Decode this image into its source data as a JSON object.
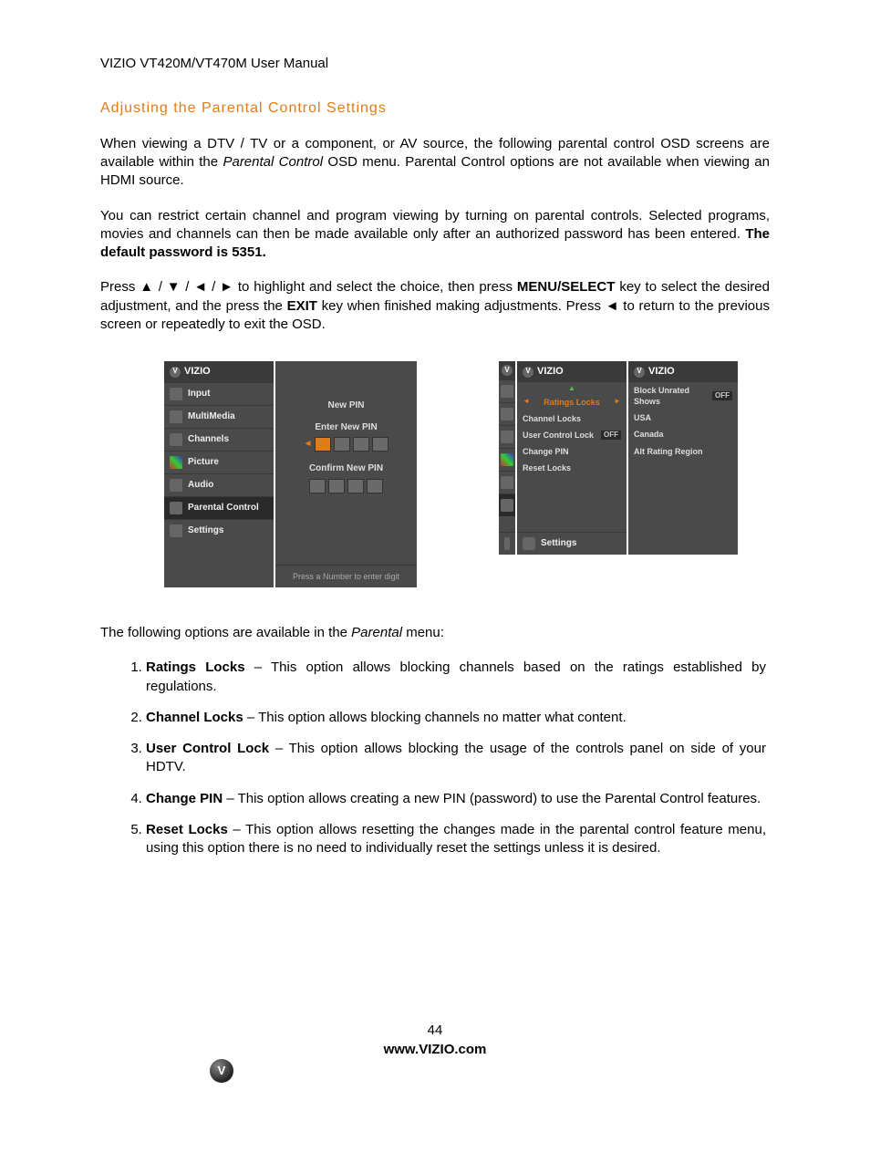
{
  "header": "VIZIO VT420M/VT470M User Manual",
  "title": "Adjusting the Parental Control Settings",
  "para1_a": "When viewing a DTV / TV or a component, or AV source, the following parental control OSD screens are available within the ",
  "para1_italic": "Parental Control",
  "para1_b": " OSD menu. Parental Control options are not available when viewing an HDMI source.",
  "para2_a": "You can restrict certain channel and program viewing by turning on parental controls. Selected programs, movies and channels can then be made available only after an authorized password has been entered. ",
  "para2_bold": "The default password is 5351.",
  "para3_a": "Press ",
  "para3_arrows": "▲ / ▼ / ◄ / ►",
  "para3_b": " to highlight and select the choice, then press ",
  "para3_menu": "MENU/SELECT",
  "para3_c": " key to select the desired adjustment, and the press the ",
  "para3_exit": "EXIT",
  "para3_d": " key when finished making adjustments. Press ",
  "para3_left": "◄",
  "para3_e": " to return to the previous screen or repeatedly to exit the OSD.",
  "osd": {
    "brand": "VIZIO",
    "sidebar": [
      "Input",
      "MultiMedia",
      "Channels",
      "Picture",
      "Audio",
      "Parental Control",
      "Settings"
    ],
    "newpin": {
      "title": "New PIN",
      "enter": "Enter New PIN",
      "confirm": "Confirm New PIN",
      "hint": "Press a Number to enter digit"
    },
    "parental_submenu": {
      "items": [
        {
          "label": "Ratings Locks",
          "hl": true,
          "arrows": true
        },
        {
          "label": "Channel Locks"
        },
        {
          "label": "User Control Lock",
          "badge": "OFF"
        },
        {
          "label": "Change PIN"
        },
        {
          "label": "Reset Locks"
        }
      ],
      "settings": "Settings"
    },
    "ratings_submenu": {
      "items": [
        {
          "label": "Block Unrated Shows",
          "badge": "OFF"
        },
        {
          "label": "USA"
        },
        {
          "label": "Canada"
        },
        {
          "label": "Alt Rating Region"
        }
      ]
    }
  },
  "options_intro_a": "The following options are available in the ",
  "options_intro_i": "Parental",
  "options_intro_b": " menu:",
  "options": [
    {
      "lead": "Ratings Locks",
      "text": " – This option allows blocking channels based on the ratings established by regulations."
    },
    {
      "lead": "Channel Locks",
      "text": " – This option allows blocking channels no matter what content."
    },
    {
      "lead": "User Control Lock",
      "text": " – This option allows blocking the usage of the controls panel on side of your HDTV."
    },
    {
      "lead": "Change PIN",
      "text": " – This option allows creating a new PIN (password) to use the Parental Control features."
    },
    {
      "lead": "Reset Locks",
      "text": " – This option allows resetting the changes made in the parental control feature menu, using this option there is no need to individually reset the settings unless it is desired."
    }
  ],
  "page_number": "44",
  "url": "www.VIZIO.com"
}
